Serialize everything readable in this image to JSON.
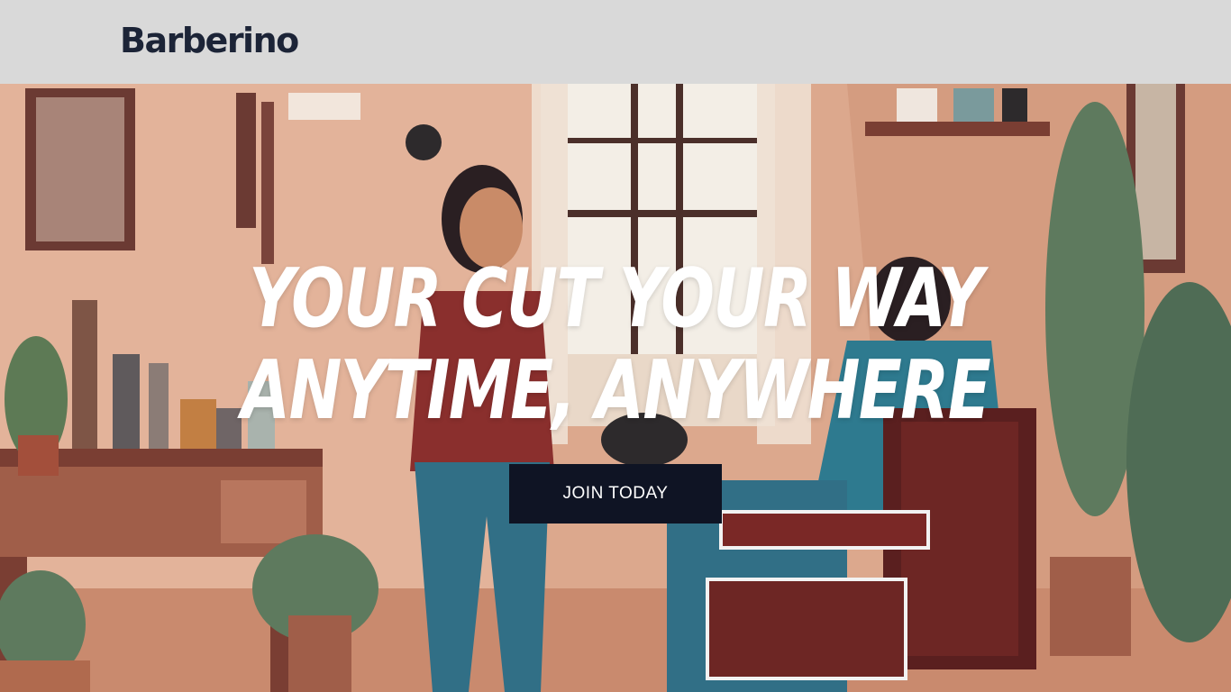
{
  "brand": {
    "name": "Barberino"
  },
  "hero": {
    "image_icon": "barbershop-illustration",
    "headline_line1": "YOUR CUT YOUR WAY",
    "headline_line2": "ANYTIME, ANYWHERE",
    "cta_label": "JOIN TODAY"
  },
  "colors": {
    "header_bg": "#d9d9d9",
    "brand_text": "#1c2437",
    "cta_bg": "#0f1424",
    "headline_text": "#ffffff"
  }
}
